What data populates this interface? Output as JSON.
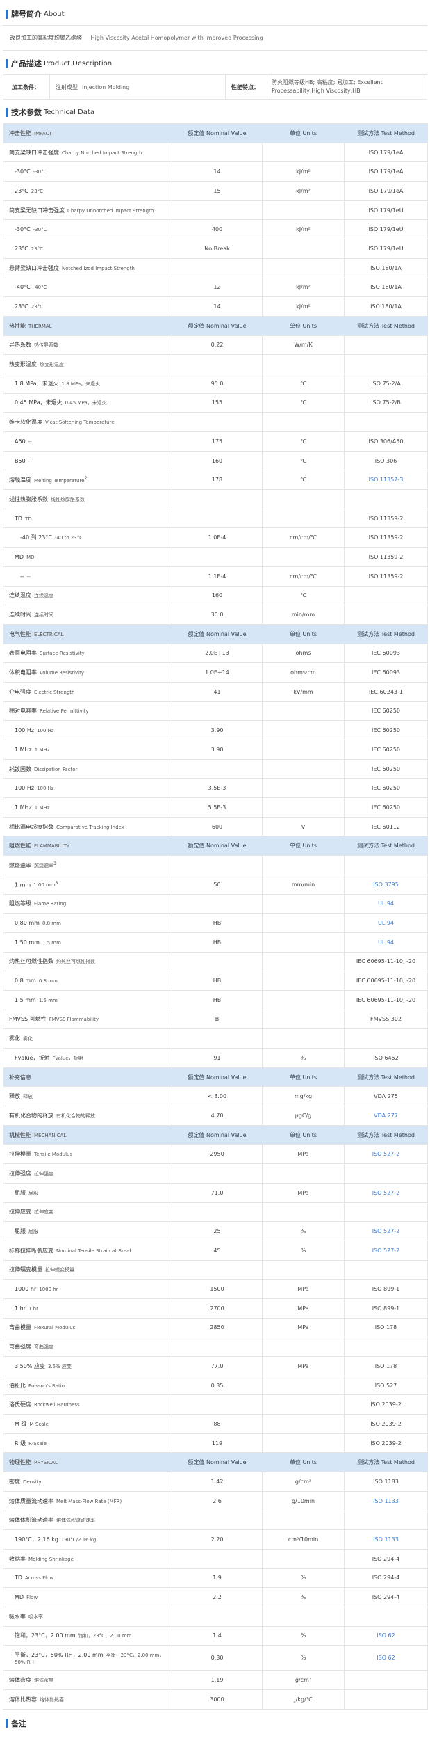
{
  "about": {
    "heading_cn": "牌号简介",
    "heading_en": "About",
    "text_cn": "改良加工的高粘度均聚乙缩醛",
    "text_en": "High Viscosity Acetal Homopolymer with Improved Processing"
  },
  "product": {
    "heading_cn": "产品描述",
    "heading_en": "Product Description",
    "proc_label": "加工条件：",
    "proc_value_cn": "注射成型",
    "proc_value_en": "Injection Molding",
    "perf_label": "性能特点：",
    "perf_value": "防火阻燃等级HB; 高粘度; 易加工; Excellent Processability,High Viscosity,HB"
  },
  "tech": {
    "heading_cn": "技术参数",
    "heading_en": "Technical Data"
  },
  "header_cols": {
    "c2": "额定值 Nominal Value",
    "c3": "单位 Units",
    "c4": "测试方法 Test Method"
  },
  "rows": [
    {
      "t": "head",
      "cn": "冲击性能",
      "en": "IMPACT"
    },
    {
      "t": "row",
      "lv": 1,
      "cn": "简支梁缺口冲击强度",
      "en": "Charpy Notched Impact Strength",
      "v": "",
      "u": "",
      "m": "ISO 179/1eA"
    },
    {
      "t": "row",
      "lv": 2,
      "cn": "-30°C",
      "en": "-30°C",
      "v": "14",
      "u": "kJ/m²",
      "m": "ISO 179/1eA"
    },
    {
      "t": "row",
      "lv": 2,
      "cn": "23°C",
      "en": "23°C",
      "v": "15",
      "u": "kJ/m²",
      "m": "ISO 179/1eA"
    },
    {
      "t": "row",
      "lv": 1,
      "cn": "简支梁无缺口冲击强度",
      "en": "Charpy Unnotched Impact Strength",
      "v": "",
      "u": "",
      "m": "ISO 179/1eU"
    },
    {
      "t": "row",
      "lv": 2,
      "cn": "-30°C",
      "en": "-30°C",
      "v": "400",
      "u": "kJ/m²",
      "m": "ISO 179/1eU"
    },
    {
      "t": "row",
      "lv": 2,
      "cn": "23°C",
      "en": "23°C",
      "v": "No Break",
      "u": "",
      "m": "ISO 179/1eU"
    },
    {
      "t": "row",
      "lv": 1,
      "cn": "悬臂梁缺口冲击强度",
      "en": "Notched Izod Impact Strength",
      "v": "",
      "u": "",
      "m": "ISO 180/1A"
    },
    {
      "t": "row",
      "lv": 2,
      "cn": "-40°C",
      "en": "-40°C",
      "v": "12",
      "u": "kJ/m²",
      "m": "ISO 180/1A"
    },
    {
      "t": "row",
      "lv": 2,
      "cn": "23°C",
      "en": "23°C",
      "v": "14",
      "u": "kJ/m²",
      "m": "ISO 180/1A"
    },
    {
      "t": "head",
      "cn": "热性能",
      "en": "THERMAL"
    },
    {
      "t": "row",
      "lv": 1,
      "cn": "导热系数",
      "en": "热传导系数",
      "v": "0.22",
      "u": "W/m/K",
      "m": ""
    },
    {
      "t": "row",
      "lv": 1,
      "cn": "热变形温度",
      "en": "热变形温度",
      "v": "",
      "u": "",
      "m": ""
    },
    {
      "t": "row",
      "lv": 2,
      "cn": "1.8 MPa，未退火",
      "en": "1.8 MPa，未退火",
      "v": "95.0",
      "u": "℃",
      "m": "ISO 75-2/A"
    },
    {
      "t": "row",
      "lv": 2,
      "cn": "0.45 MPa，未退火",
      "en": "0.45 MPa，未退火",
      "v": "155",
      "u": "℃",
      "m": "ISO 75-2/B"
    },
    {
      "t": "row",
      "lv": 1,
      "cn": "维卡软化温度",
      "en": "Vicat Softening Temperature",
      "v": "",
      "u": "",
      "m": ""
    },
    {
      "t": "row",
      "lv": 2,
      "cn": "A50",
      "en": "--",
      "v": "175",
      "u": "℃",
      "m": "ISO 306/A50"
    },
    {
      "t": "row",
      "lv": 2,
      "cn": "B50",
      "en": "--",
      "v": "160",
      "u": "℃",
      "m": "ISO 306"
    },
    {
      "t": "row",
      "lv": 1,
      "cn": "熔融温度",
      "en": "Melting Temperature",
      "sup": "2",
      "v": "178",
      "u": "℃",
      "m": "ISO 11357-3",
      "ml": true
    },
    {
      "t": "row",
      "lv": 1,
      "cn": "线性热膨胀系数",
      "en": "线性热膨胀系数",
      "v": "",
      "u": "",
      "m": ""
    },
    {
      "t": "row",
      "lv": 2,
      "cn": "TD",
      "en": "TD",
      "v": "",
      "u": "",
      "m": "ISO 11359-2"
    },
    {
      "t": "row",
      "lv": 3,
      "cn": "-40 到 23°C",
      "en": "-40 to 23°C",
      "v": "1.0E-4",
      "u": "cm/cm/℃",
      "m": "ISO 11359-2"
    },
    {
      "t": "row",
      "lv": 2,
      "cn": "MD",
      "en": "MD",
      "v": "",
      "u": "",
      "m": "ISO 11359-2"
    },
    {
      "t": "row",
      "lv": 3,
      "cn": "--",
      "en": "--",
      "v": "1.1E-4",
      "u": "cm/cm/℃",
      "m": "ISO 11359-2"
    },
    {
      "t": "row",
      "lv": 1,
      "cn": "连续温度",
      "en": "连续温度",
      "v": "160",
      "u": "℃",
      "m": ""
    },
    {
      "t": "row",
      "lv": 1,
      "cn": "连续时间",
      "en": "连续时间",
      "v": "30.0",
      "u": "min/mm",
      "m": ""
    },
    {
      "t": "head",
      "cn": "电气性能",
      "en": "ELECTRICAL"
    },
    {
      "t": "row",
      "lv": 1,
      "cn": "表面电阻率",
      "en": "Surface Resistivity",
      "v": "2.0E+13",
      "u": "ohms",
      "m": "IEC 60093"
    },
    {
      "t": "row",
      "lv": 1,
      "cn": "体积电阻率",
      "en": "Volume Resistivity",
      "v": "1.0E+14",
      "u": "ohms·cm",
      "m": "IEC 60093"
    },
    {
      "t": "row",
      "lv": 1,
      "cn": "介电强度",
      "en": "Electric Strength",
      "v": "41",
      "u": "kV/mm",
      "m": "IEC 60243-1"
    },
    {
      "t": "row",
      "lv": 1,
      "cn": "相对电容率",
      "en": "Relative Permittivity",
      "v": "",
      "u": "",
      "m": "IEC 60250"
    },
    {
      "t": "row",
      "lv": 2,
      "cn": "100 Hz",
      "en": "100 Hz",
      "v": "3.90",
      "u": "",
      "m": "IEC 60250"
    },
    {
      "t": "row",
      "lv": 2,
      "cn": "1 MHz",
      "en": "1 MHz",
      "v": "3.90",
      "u": "",
      "m": "IEC 60250"
    },
    {
      "t": "row",
      "lv": 1,
      "cn": "耗散因数",
      "en": "Dissipation Factor",
      "v": "",
      "u": "",
      "m": "IEC 60250"
    },
    {
      "t": "row",
      "lv": 2,
      "cn": "100 Hz",
      "en": "100 Hz",
      "v": "3.5E-3",
      "u": "",
      "m": "IEC 60250"
    },
    {
      "t": "row",
      "lv": 2,
      "cn": "1 MHz",
      "en": "1 MHz",
      "v": "5.5E-3",
      "u": "",
      "m": "IEC 60250"
    },
    {
      "t": "row",
      "lv": 1,
      "cn": "相比漏电起痕指数",
      "en": "Comparative Tracking Index",
      "v": "600",
      "u": "V",
      "m": "IEC 60112"
    },
    {
      "t": "head",
      "cn": "阻燃性能",
      "en": "FLAMMABILITY"
    },
    {
      "t": "row",
      "lv": 1,
      "cn": "燃烧速率",
      "en": "燃烧速率",
      "sup": "3",
      "v": "",
      "u": "",
      "m": ""
    },
    {
      "t": "row",
      "lv": 2,
      "cn": "1 mm",
      "en": "1.00 mm",
      "sup": "3",
      "v": "50",
      "u": "mm/min",
      "m": "ISO 3795",
      "ml": true
    },
    {
      "t": "row",
      "lv": 1,
      "cn": "阻燃等级",
      "en": "Flame Rating",
      "v": "",
      "u": "",
      "m": "UL 94",
      "ml": true
    },
    {
      "t": "row",
      "lv": 2,
      "cn": "0.80 mm",
      "en": "0.8 mm",
      "v": "HB",
      "u": "",
      "m": "UL 94",
      "ml": true
    },
    {
      "t": "row",
      "lv": 2,
      "cn": "1.50 mm",
      "en": "1.5 mm",
      "v": "HB",
      "u": "",
      "m": "UL 94",
      "ml": true
    },
    {
      "t": "row",
      "lv": 1,
      "cn": "灼热丝可燃性指数",
      "en": "灼热丝可燃性指数",
      "v": "",
      "u": "",
      "m": "IEC 60695-11-10, -20"
    },
    {
      "t": "row",
      "lv": 2,
      "cn": "0.8 mm",
      "en": "0.8 mm",
      "v": "HB",
      "u": "",
      "m": "IEC 60695-11-10, -20"
    },
    {
      "t": "row",
      "lv": 2,
      "cn": "1.5 mm",
      "en": "1.5 mm",
      "v": "HB",
      "u": "",
      "m": "IEC 60695-11-10, -20"
    },
    {
      "t": "row",
      "lv": 1,
      "cn": "FMVSS 可燃性",
      "en": "FMVSS Flammability",
      "v": "B",
      "u": "",
      "m": "FMVSS 302"
    },
    {
      "t": "row",
      "lv": 1,
      "cn": "雾化",
      "en": "雾化",
      "v": "",
      "u": "",
      "m": ""
    },
    {
      "t": "row",
      "lv": 2,
      "cn": "Fvalue，折射",
      "en": "Fvalue，折射",
      "v": "91",
      "u": "%",
      "m": "ISO 6452"
    },
    {
      "t": "head",
      "cn": "补充信息",
      "en": ""
    },
    {
      "t": "row",
      "lv": 1,
      "cn": "释放",
      "en": "释放",
      "v": "< 8.00",
      "u": "mg/kg",
      "m": "VDA 275"
    },
    {
      "t": "row",
      "lv": 1,
      "cn": "有机化合物的释放",
      "en": "有机化合物的释放",
      "v": "4.70",
      "u": "µgC/g",
      "m": "VDA 277",
      "ml": true
    },
    {
      "t": "head",
      "cn": "机械性能",
      "en": "MECHANICAL"
    },
    {
      "t": "row",
      "lv": 1,
      "cn": "拉伸模量",
      "en": "Tensile Modulus",
      "v": "2950",
      "u": "MPa",
      "m": "ISO 527-2",
      "ml": true
    },
    {
      "t": "row",
      "lv": 1,
      "cn": "拉伸强度",
      "en": "拉伸强度",
      "v": "",
      "u": "",
      "m": ""
    },
    {
      "t": "row",
      "lv": 2,
      "cn": "屈服",
      "en": "屈服",
      "v": "71.0",
      "u": "MPa",
      "m": "ISO 527-2",
      "ml": true
    },
    {
      "t": "row",
      "lv": 1,
      "cn": "拉伸应变",
      "en": "拉伸应变",
      "v": "",
      "u": "",
      "m": ""
    },
    {
      "t": "row",
      "lv": 2,
      "cn": "屈服",
      "en": "屈服",
      "v": "25",
      "u": "%",
      "m": "ISO 527-2",
      "ml": true
    },
    {
      "t": "row",
      "lv": 1,
      "cn": "标称拉伸断裂应变",
      "en": "Nominal Tensile Strain at Break",
      "v": "45",
      "u": "%",
      "m": "ISO 527-2",
      "ml": true
    },
    {
      "t": "row",
      "lv": 1,
      "cn": "拉伸蠕变模量",
      "en": "拉伸蠕变模量",
      "v": "",
      "u": "",
      "m": ""
    },
    {
      "t": "row",
      "lv": 2,
      "cn": "1000 hr",
      "en": "1000 hr",
      "v": "1500",
      "u": "MPa",
      "m": "ISO 899-1"
    },
    {
      "t": "row",
      "lv": 2,
      "cn": "1 hr",
      "en": "1 hr",
      "v": "2700",
      "u": "MPa",
      "m": "ISO 899-1"
    },
    {
      "t": "row",
      "lv": 1,
      "cn": "弯曲模量",
      "en": "Flexural Modulus",
      "v": "2850",
      "u": "MPa",
      "m": "ISO 178"
    },
    {
      "t": "row",
      "lv": 1,
      "cn": "弯曲强度",
      "en": "弯曲强度",
      "v": "",
      "u": "",
      "m": ""
    },
    {
      "t": "row",
      "lv": 2,
      "cn": "3.50% 应变",
      "en": "3.5% 应变",
      "v": "77.0",
      "u": "MPa",
      "m": "ISO 178"
    },
    {
      "t": "row",
      "lv": 1,
      "cn": "泊松比",
      "en": "Poisson's Ratio",
      "v": "0.35",
      "u": "",
      "m": "ISO 527"
    },
    {
      "t": "row",
      "lv": 1,
      "cn": "洛氏硬度",
      "en": "Rockwell Hardness",
      "v": "",
      "u": "",
      "m": "ISO 2039-2"
    },
    {
      "t": "row",
      "lv": 2,
      "cn": "M 级",
      "en": "M-Scale",
      "v": "88",
      "u": "",
      "m": "ISO 2039-2"
    },
    {
      "t": "row",
      "lv": 2,
      "cn": "R 级",
      "en": "R-Scale",
      "v": "119",
      "u": "",
      "m": "ISO 2039-2"
    },
    {
      "t": "head",
      "cn": "物理性能",
      "en": "PHYSICAL"
    },
    {
      "t": "row",
      "lv": 1,
      "cn": "密度",
      "en": "Density",
      "v": "1.42",
      "u": "g/cm³",
      "m": "ISO 1183"
    },
    {
      "t": "row",
      "lv": 1,
      "cn": "熔体质量流动速率",
      "en": "Melt Mass-Flow Rate (MFR)",
      "v": "2.6",
      "u": "g/10min",
      "m": "ISO 1133",
      "ml": true
    },
    {
      "t": "row",
      "lv": 1,
      "cn": "熔体体积流动速率",
      "en": "熔体体积流动速率",
      "v": "",
      "u": "",
      "m": ""
    },
    {
      "t": "row",
      "lv": 2,
      "cn": "190°C，2.16 kg",
      "en": "190°C/2.16 kg",
      "v": "2.20",
      "u": "cm³/10min",
      "m": "ISO 1133",
      "ml": true
    },
    {
      "t": "row",
      "lv": 1,
      "cn": "收缩率",
      "en": "Molding Shrinkage",
      "v": "",
      "u": "",
      "m": "ISO 294-4"
    },
    {
      "t": "row",
      "lv": 2,
      "cn": "TD",
      "en": "Across Flow",
      "v": "1.9",
      "u": "%",
      "m": "ISO 294-4"
    },
    {
      "t": "row",
      "lv": 2,
      "cn": "MD",
      "en": "Flow",
      "v": "2.2",
      "u": "%",
      "m": "ISO 294-4"
    },
    {
      "t": "row",
      "lv": 1,
      "cn": "吸水率",
      "en": "吸水率",
      "v": "",
      "u": "",
      "m": ""
    },
    {
      "t": "row",
      "lv": 2,
      "cn": "饱和，23°C，2.00 mm",
      "en": "饱和，23°C，2.00 mm",
      "v": "1.4",
      "u": "%",
      "m": "ISO 62",
      "ml": true
    },
    {
      "t": "row",
      "lv": 2,
      "cn": "平衡，23°C，50% RH，2.00 mm",
      "en": "平衡，23°C，2.00 mm，50% RH",
      "v": "0.30",
      "u": "%",
      "m": "ISO 62",
      "ml": true,
      "tall": true
    },
    {
      "t": "row",
      "lv": 1,
      "cn": "熔体密度",
      "en": "熔体密度",
      "v": "1.19",
      "u": "g/cm³",
      "m": ""
    },
    {
      "t": "row",
      "lv": 1,
      "cn": "熔体比热容",
      "en": "熔体比热容",
      "v": "3000",
      "u": "J/kg/℃",
      "m": ""
    }
  ],
  "notes": {
    "heading_cn": "备注"
  },
  "colors": {
    "accent": "#2f74c0",
    "header_row": "#d6e6f7",
    "link": "#3a7bd5"
  }
}
